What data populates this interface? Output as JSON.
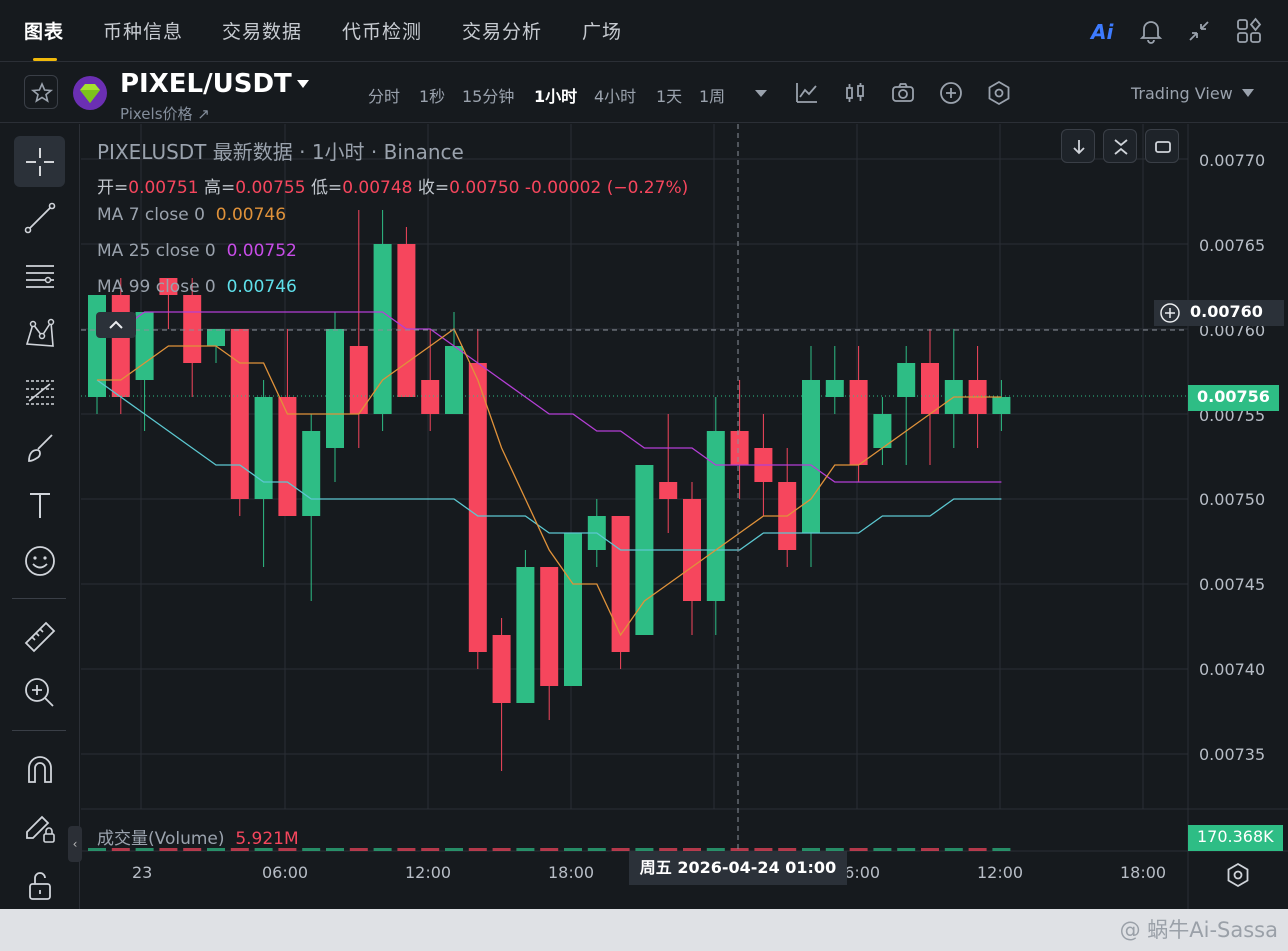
{
  "nav": {
    "tabs": [
      "图表",
      "币种信息",
      "交易数据",
      "代币检测",
      "交易分析",
      "广场"
    ],
    "active_tab": "图表",
    "ai_label": "Ai",
    "icons": [
      "ai-icon",
      "bell-icon",
      "collapse-arrows-icon",
      "layout-grid-icon"
    ]
  },
  "symbol": {
    "pair": "PIXEL/USDT",
    "subtitle": "Pixels价格 ↗",
    "timeframes": [
      "分时",
      "1秒",
      "15分钟",
      "1小时",
      "4小时",
      "1天",
      "1周"
    ],
    "active_timeframe": "1小时",
    "tools": [
      "dropdown-icon",
      "indicator-icon",
      "candle-type-icon",
      "camera-icon",
      "plus-circle-icon",
      "settings-hex-icon"
    ],
    "view_label": "Trading View"
  },
  "legend": {
    "title": "PIXELUSDT 最新数据 · 1小时 · Binance",
    "ohlc_open_label": "开=",
    "ohlc_open": "0.00751",
    "ohlc_high_label": "高=",
    "ohlc_high": "0.00755",
    "ohlc_low_label": "低=",
    "ohlc_low": "0.00748",
    "ohlc_close_label": "收=",
    "ohlc_close": "0.00750",
    "change": "-0.00002 (−0.27%)",
    "ma7_label": "MA 7 close 0",
    "ma7_value": "0.00746",
    "ma25_label": "MA 25 close 0",
    "ma25_value": "0.00752",
    "ma99_label": "MA 99 close 0",
    "ma99_value": "0.00746"
  },
  "price_axis": {
    "ticks": [
      "0.00770",
      "0.00765",
      "0.00760",
      "0.00755",
      "0.00750",
      "0.00745",
      "0.00740",
      "0.00735"
    ],
    "crosshair_price": "0.00760",
    "last_price": "0.00756",
    "volume_value": "170.368K"
  },
  "time_axis": {
    "ticks": [
      "23",
      "06:00",
      "12:00",
      "18:00",
      "06:00",
      "12:00",
      "18:00"
    ],
    "cursor_label": "周五 2026-04-24    01:00"
  },
  "volume": {
    "label": "成交量(Volume)",
    "value": "5.921M"
  },
  "colors": {
    "up": "#2ebd85",
    "down": "#f6465d",
    "ma7": "#e0923a",
    "ma25": "#b43fd6",
    "ma99": "#5cc8d1",
    "accent": "#f0b90b"
  },
  "watermark": "@ 蜗牛Ai-Sassa",
  "chart_data": {
    "type": "candlestick",
    "title": "PIXELUSDT 最新数据 · 1小时 · Binance",
    "ylim": [
      0.00732,
      0.00775
    ],
    "x_tick_labels": [
      "23",
      "06:00",
      "12:00",
      "18:00",
      "06:00",
      "12:00",
      "18:00"
    ],
    "candles": [
      {
        "o": 0.00756,
        "h": 0.00762,
        "l": 0.00755,
        "c": 0.00762
      },
      {
        "o": 0.00762,
        "h": 0.00763,
        "l": 0.00755,
        "c": 0.00756
      },
      {
        "o": 0.00757,
        "h": 0.00761,
        "l": 0.00754,
        "c": 0.00761
      },
      {
        "o": 0.00763,
        "h": 0.00763,
        "l": 0.0076,
        "c": 0.00762
      },
      {
        "o": 0.00762,
        "h": 0.00763,
        "l": 0.00756,
        "c": 0.00758
      },
      {
        "o": 0.00759,
        "h": 0.0076,
        "l": 0.00758,
        "c": 0.0076
      },
      {
        "o": 0.0076,
        "h": 0.0076,
        "l": 0.00749,
        "c": 0.0075
      },
      {
        "o": 0.0075,
        "h": 0.00757,
        "l": 0.00746,
        "c": 0.00756
      },
      {
        "o": 0.00756,
        "h": 0.0076,
        "l": 0.00749,
        "c": 0.00749
      },
      {
        "o": 0.00749,
        "h": 0.00755,
        "l": 0.00744,
        "c": 0.00754
      },
      {
        "o": 0.00753,
        "h": 0.00761,
        "l": 0.00751,
        "c": 0.0076
      },
      {
        "o": 0.00759,
        "h": 0.00767,
        "l": 0.00753,
        "c": 0.00755
      },
      {
        "o": 0.00755,
        "h": 0.00767,
        "l": 0.00754,
        "c": 0.00765
      },
      {
        "o": 0.00765,
        "h": 0.00766,
        "l": 0.00756,
        "c": 0.00756
      },
      {
        "o": 0.00757,
        "h": 0.0076,
        "l": 0.00754,
        "c": 0.00755
      },
      {
        "o": 0.00755,
        "h": 0.00761,
        "l": 0.00755,
        "c": 0.00759
      },
      {
        "o": 0.00758,
        "h": 0.0076,
        "l": 0.0074,
        "c": 0.00741
      },
      {
        "o": 0.00742,
        "h": 0.00743,
        "l": 0.00734,
        "c": 0.00738
      },
      {
        "o": 0.00738,
        "h": 0.00747,
        "l": 0.00738,
        "c": 0.00746
      },
      {
        "o": 0.00746,
        "h": 0.00746,
        "l": 0.00737,
        "c": 0.00739
      },
      {
        "o": 0.00739,
        "h": 0.00748,
        "l": 0.00739,
        "c": 0.00748
      },
      {
        "o": 0.00747,
        "h": 0.0075,
        "l": 0.00746,
        "c": 0.00749
      },
      {
        "o": 0.00749,
        "h": 0.00749,
        "l": 0.0074,
        "c": 0.00741
      },
      {
        "o": 0.00742,
        "h": 0.00752,
        "l": 0.00742,
        "c": 0.00752
      },
      {
        "o": 0.00751,
        "h": 0.00755,
        "l": 0.00748,
        "c": 0.0075
      },
      {
        "o": 0.0075,
        "h": 0.00751,
        "l": 0.00742,
        "c": 0.00744
      },
      {
        "o": 0.00744,
        "h": 0.00756,
        "l": 0.00742,
        "c": 0.00754
      },
      {
        "o": 0.00754,
        "h": 0.00757,
        "l": 0.0075,
        "c": 0.00752
      },
      {
        "o": 0.00753,
        "h": 0.00755,
        "l": 0.00749,
        "c": 0.00751
      },
      {
        "o": 0.00751,
        "h": 0.00753,
        "l": 0.00746,
        "c": 0.00747
      },
      {
        "o": 0.00748,
        "h": 0.00759,
        "l": 0.00746,
        "c": 0.00757
      },
      {
        "o": 0.00756,
        "h": 0.00759,
        "l": 0.00755,
        "c": 0.00757
      },
      {
        "o": 0.00757,
        "h": 0.00759,
        "l": 0.00751,
        "c": 0.00752
      },
      {
        "o": 0.00753,
        "h": 0.00756,
        "l": 0.00752,
        "c": 0.00755
      },
      {
        "o": 0.00756,
        "h": 0.00759,
        "l": 0.00752,
        "c": 0.00758
      },
      {
        "o": 0.00758,
        "h": 0.0076,
        "l": 0.00752,
        "c": 0.00755
      },
      {
        "o": 0.00755,
        "h": 0.0076,
        "l": 0.00753,
        "c": 0.00757
      },
      {
        "o": 0.00757,
        "h": 0.00759,
        "l": 0.00753,
        "c": 0.00755
      },
      {
        "o": 0.00755,
        "h": 0.00757,
        "l": 0.00754,
        "c": 0.00756
      }
    ],
    "ma7": [
      0.00757,
      0.00757,
      0.00758,
      0.00759,
      0.00759,
      0.00759,
      0.00758,
      0.00758,
      0.00755,
      0.00755,
      0.00755,
      0.00755,
      0.00757,
      0.00758,
      0.00759,
      0.0076,
      0.00757,
      0.00753,
      0.0075,
      0.00747,
      0.00745,
      0.00745,
      0.00742,
      0.00744,
      0.00745,
      0.00746,
      0.00747,
      0.00748,
      0.00749,
      0.00749,
      0.0075,
      0.00752,
      0.00752,
      0.00753,
      0.00754,
      0.00755,
      0.00756,
      0.00756,
      0.00756
    ],
    "ma25": [
      0.0076,
      0.0076,
      0.00761,
      0.00761,
      0.00761,
      0.00761,
      0.00761,
      0.00761,
      0.00761,
      0.00761,
      0.00761,
      0.00761,
      0.00761,
      0.0076,
      0.0076,
      0.00759,
      0.00758,
      0.00757,
      0.00756,
      0.00755,
      0.00755,
      0.00754,
      0.00754,
      0.00753,
      0.00753,
      0.00753,
      0.00752,
      0.00752,
      0.00752,
      0.00752,
      0.00752,
      0.00751,
      0.00751,
      0.00751,
      0.00751,
      0.00751,
      0.00751,
      0.00751,
      0.00751
    ],
    "ma99": [
      0.00757,
      0.00756,
      0.00755,
      0.00754,
      0.00753,
      0.00752,
      0.00752,
      0.00751,
      0.00751,
      0.0075,
      0.0075,
      0.0075,
      0.0075,
      0.0075,
      0.0075,
      0.0075,
      0.00749,
      0.00749,
      0.00749,
      0.00748,
      0.00748,
      0.00748,
      0.00747,
      0.00747,
      0.00747,
      0.00747,
      0.00747,
      0.00747,
      0.00748,
      0.00748,
      0.00748,
      0.00748,
      0.00748,
      0.00749,
      0.00749,
      0.00749,
      0.0075,
      0.0075,
      0.0075
    ]
  }
}
